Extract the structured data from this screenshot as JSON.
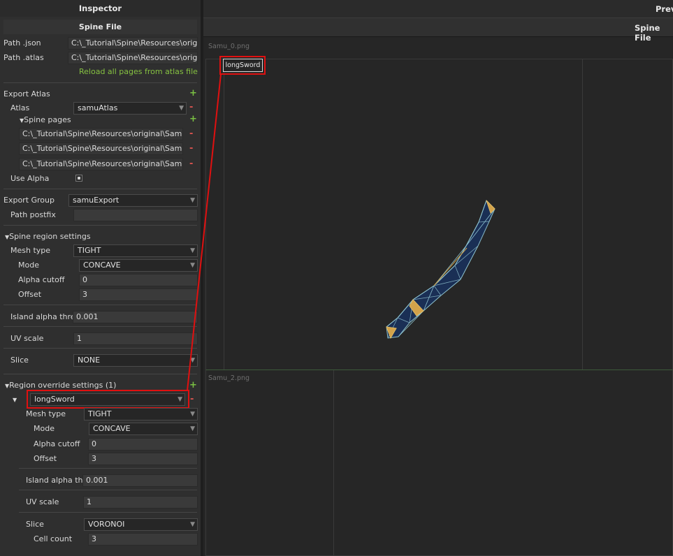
{
  "inspector": {
    "title": "Inspector",
    "section": "Spine File",
    "path_json_label": "Path .json",
    "path_json_value": "C:\\_Tutorial\\Spine\\Resources\\orig",
    "path_atlas_label": "Path .atlas",
    "path_atlas_value": "C:\\_Tutorial\\Spine\\Resources\\orig",
    "reload_link": "Reload all pages from atlas file",
    "export_atlas_label": "Export Atlas",
    "atlas_label": "Atlas",
    "atlas_value": "samuAtlas",
    "spine_pages_label": "Spine pages",
    "spine_pages": [
      "C:\\_Tutorial\\Spine\\Resources\\original\\Sam",
      "C:\\_Tutorial\\Spine\\Resources\\original\\Sam",
      "C:\\_Tutorial\\Spine\\Resources\\original\\Sam"
    ],
    "use_alpha_label": "Use Alpha",
    "export_group_label": "Export Group",
    "export_group_value": "samuExport",
    "path_postfix_label": "Path postfix",
    "path_postfix_value": "",
    "region_settings_label": "Spine region settings",
    "mesh_type_label": "Mesh type",
    "mesh_type_value": "TIGHT",
    "mode_label": "Mode",
    "mode_value": "CONCAVE",
    "alpha_cutoff_label": "Alpha cutoff",
    "alpha_cutoff_value": "0",
    "offset_label": "Offset",
    "offset_value": "3",
    "island_label": "Island alpha thre",
    "island_value": "0.001",
    "uv_scale_label": "UV scale",
    "uv_scale_value": "1",
    "slice_label": "Slice",
    "slice_value": "NONE",
    "override_label": "Region override settings (1)",
    "override": {
      "region_value": "longSword",
      "mesh_type_label": "Mesh type",
      "mesh_type_value": "TIGHT",
      "mode_label": "Mode",
      "mode_value": "CONCAVE",
      "alpha_cutoff_label": "Alpha cutoff",
      "alpha_cutoff_value": "0",
      "offset_label": "Offset",
      "offset_value": "3",
      "island_label": "Island alpha th",
      "island_value": "0.001",
      "uv_scale_label": "UV scale",
      "uv_scale_value": "1",
      "slice_label": "Slice",
      "slice_value": "VORONOI",
      "cell_count_label": "Cell count",
      "cell_count_value": "3"
    }
  },
  "preview": {
    "title": "Preview",
    "subtitle": "Spine File",
    "page1_label": "Samu_0.png",
    "page2_label": "Samu_2.png",
    "region_tag": "longSword"
  },
  "colors": {
    "accent_link": "#85c041",
    "add": "#7ac143",
    "remove": "#d9534f",
    "highlight": "#e01010",
    "mesh_fill": "#1a2f55",
    "mesh_edge": "#8ec3d0",
    "mesh_gold": "#d2a24a"
  },
  "icons": {
    "add": "plus-icon",
    "remove": "minus-icon",
    "expand": "triangle-down-icon",
    "dropdown": "chevron-down-icon",
    "checkbox": "checkbox-icon"
  }
}
